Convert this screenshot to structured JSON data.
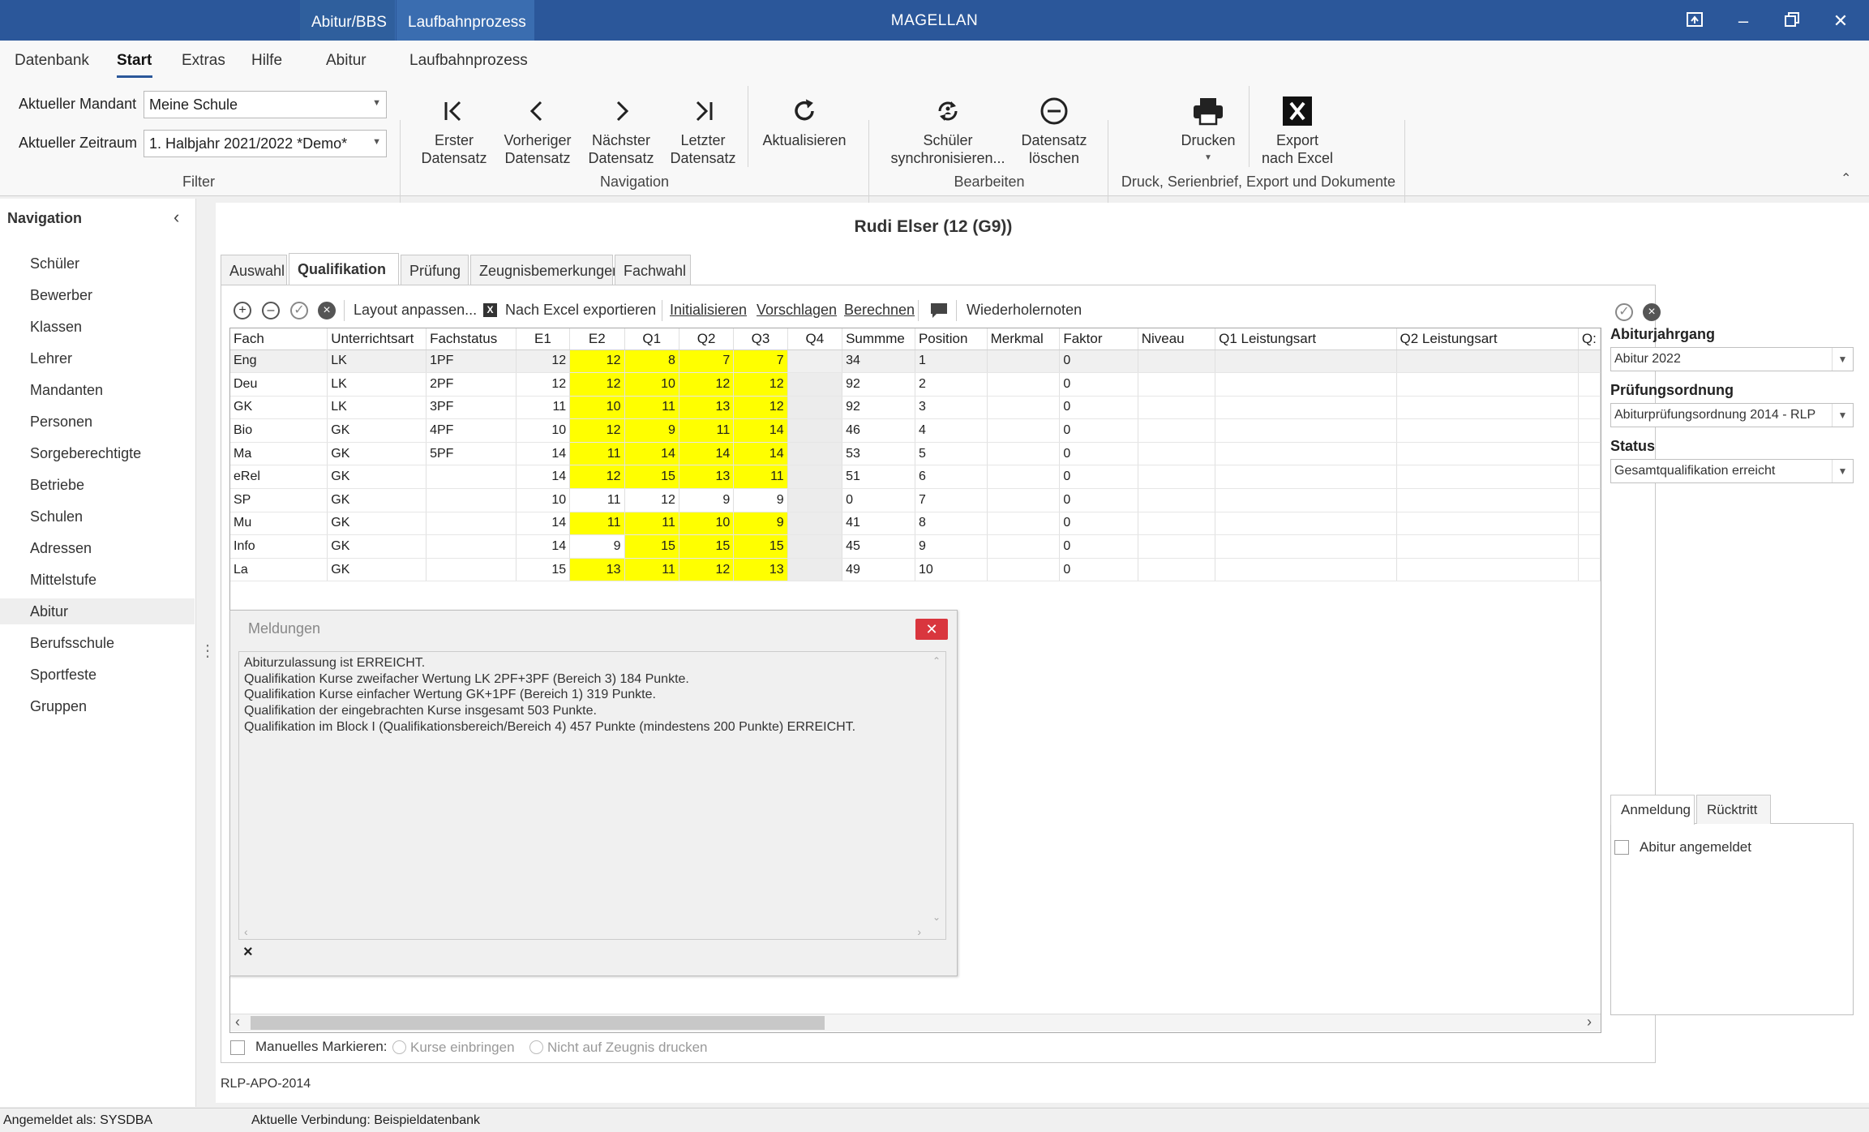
{
  "titlebar": {
    "context_tabs": [
      "Abitur/BBS",
      "Laufbahnprozess"
    ],
    "app_title": "MAGELLAN"
  },
  "menu": [
    "Datenbank",
    "Start",
    "Extras",
    "Hilfe",
    "Abitur",
    "Laufbahnprozess"
  ],
  "filter": {
    "mandant_label": "Aktueller Mandant",
    "mandant_value": "Meine Schule",
    "zeitraum_label": "Aktueller Zeitraum",
    "zeitraum_value": "1. Halbjahr 2021/2022 *Demo*",
    "group_label": "Filter"
  },
  "ribbon": {
    "navigation": {
      "first": "Erster\nDatensatz",
      "prev": "Vorheriger\nDatensatz",
      "next": "Nächster\nDatensatz",
      "last": "Letzter\nDatensatz",
      "refresh": "Aktualisieren",
      "group_label": "Navigation"
    },
    "bearbeiten": {
      "sync": "Schüler\nsynchronisieren...",
      "delete": "Datensatz\nlöschen",
      "group_label": "Bearbeiten"
    },
    "druck": {
      "print": "Drucken",
      "export": "Export\nnach Excel",
      "group_label": "Druck, Serienbrief, Export und Dokumente"
    }
  },
  "navigation": {
    "title": "Navigation",
    "items": [
      "Schüler",
      "Bewerber",
      "Klassen",
      "Lehrer",
      "Mandanten",
      "Personen",
      "Sorgeberechtigte",
      "Betriebe",
      "Schulen",
      "Adressen",
      "Mittelstufe",
      "Abitur",
      "Berufsschule",
      "Sportfeste",
      "Gruppen"
    ],
    "selected": "Abitur"
  },
  "student": {
    "name": "Rudi Elser (12 (G9))"
  },
  "tabs": [
    "Auswahl",
    "Qualifikation",
    "Prüfung",
    "Zeugnisbemerkungen",
    "Fachwahl"
  ],
  "active_tab": "Qualifikation",
  "toolbar": {
    "layout": "Layout anpassen...",
    "excel": "Nach Excel exportieren",
    "init": "Initialisieren",
    "suggest": "Vorschlagen",
    "calc": "Berechnen",
    "repeat": "Wiederholernoten"
  },
  "grid": {
    "columns": [
      "Fach",
      "Unterrichtsart",
      "Fachstatus",
      "E1",
      "E2",
      "Q1",
      "Q2",
      "Q3",
      "Q4",
      "Summme",
      "Position",
      "Merkmal",
      "Faktor",
      "Niveau",
      "Q1 Leistungsart",
      "Q2 Leistungsart",
      "Q:"
    ],
    "rows": [
      {
        "fach": "Eng",
        "art": "LK",
        "status": "1PF",
        "e1": "12",
        "e2": "12",
        "q1": "8",
        "q2": "7",
        "q3": "7",
        "q4": "",
        "summe": "34",
        "pos": "1",
        "merkmal": "",
        "faktor": "0"
      },
      {
        "fach": "Deu",
        "art": "LK",
        "status": "2PF",
        "e1": "12",
        "e2": "12",
        "q1": "10",
        "q2": "12",
        "q3": "12",
        "q4": "",
        "summe": "92",
        "pos": "2",
        "merkmal": "",
        "faktor": "0"
      },
      {
        "fach": "GK",
        "art": "LK",
        "status": "3PF",
        "e1": "11",
        "e2": "10",
        "q1": "11",
        "q2": "13",
        "q3": "12",
        "q4": "",
        "summe": "92",
        "pos": "3",
        "merkmal": "",
        "faktor": "0"
      },
      {
        "fach": "Bio",
        "art": "GK",
        "status": "4PF",
        "e1": "10",
        "e2": "12",
        "q1": "9",
        "q2": "11",
        "q3": "14",
        "q4": "",
        "summe": "46",
        "pos": "4",
        "merkmal": "",
        "faktor": "0"
      },
      {
        "fach": "Ma",
        "art": "GK",
        "status": "5PF",
        "e1": "14",
        "e2": "11",
        "q1": "14",
        "q2": "14",
        "q3": "14",
        "q4": "",
        "summe": "53",
        "pos": "5",
        "merkmal": "",
        "faktor": "0"
      },
      {
        "fach": "eRel",
        "art": "GK",
        "status": "",
        "e1": "14",
        "e2": "12",
        "q1": "15",
        "q2": "13",
        "q3": "11",
        "q4": "",
        "summe": "51",
        "pos": "6",
        "merkmal": "",
        "faktor": "0"
      },
      {
        "fach": "SP",
        "art": "GK",
        "status": "",
        "e1": "10",
        "e2": "11",
        "q1": "12",
        "q2": "9",
        "q3": "9",
        "q4": "",
        "summe": "0",
        "pos": "7",
        "merkmal": "",
        "faktor": "0"
      },
      {
        "fach": "Mu",
        "art": "GK",
        "status": "",
        "e1": "14",
        "e2": "11",
        "q1": "11",
        "q2": "10",
        "q3": "9",
        "q4": "",
        "summe": "41",
        "pos": "8",
        "merkmal": "",
        "faktor": "0"
      },
      {
        "fach": "Info",
        "art": "GK",
        "status": "",
        "e1": "14",
        "e2": "9",
        "q1": "15",
        "q2": "15",
        "q3": "15",
        "q4": "",
        "summe": "45",
        "pos": "9",
        "merkmal": "",
        "faktor": "0"
      },
      {
        "fach": "La",
        "art": "GK",
        "status": "",
        "e1": "15",
        "e2": "13",
        "q1": "11",
        "q2": "12",
        "q3": "13",
        "q4": "",
        "summe": "49",
        "pos": "10",
        "merkmal": "",
        "faktor": "0"
      }
    ],
    "highlight": [
      [
        true,
        true,
        true,
        true
      ],
      [
        true,
        true,
        true,
        true
      ],
      [
        true,
        true,
        true,
        true
      ],
      [
        true,
        true,
        true,
        true
      ],
      [
        true,
        true,
        true,
        true
      ],
      [
        true,
        true,
        true,
        true
      ],
      [
        false,
        false,
        false,
        false
      ],
      [
        true,
        true,
        true,
        true
      ],
      [
        false,
        true,
        true,
        true
      ],
      [
        true,
        true,
        true,
        true
      ]
    ],
    "highlight_color": "#ffff00"
  },
  "dialog": {
    "title": "Meldungen",
    "lines": [
      "Abiturzulassung ist ERREICHT.",
      "Qualifikation Kurse zweifacher Wertung LK 2PF+3PF (Bereich 3) 184 Punkte.",
      "Qualifikation Kurse einfacher Wertung GK+1PF (Bereich 1) 319 Punkte.",
      "Qualifikation der eingebrachten Kurse insgesamt 503 Punkte.",
      "Qualifikation im Block I (Qualifikationsbereich/Bereich 4) 457 Punkte (mindestens 200 Punkte) ERREICHT."
    ]
  },
  "bottom_options": {
    "manual": "Manuelles Markieren:",
    "kurse": "Kurse einbringen",
    "nicht": "Nicht auf Zeugnis drucken"
  },
  "right_panel": {
    "jahrgang_label": "Abiturjahrgang",
    "jahrgang_value": "Abitur 2022",
    "ordnung_label": "Prüfungsordnung",
    "ordnung_value": "Abiturprüfungsordnung 2014 - RLP",
    "status_label": "Status",
    "status_value": "Gesamtqualifikation erreicht",
    "tabs": [
      "Anmeldung",
      "Rücktritt"
    ],
    "checkbox_label": "Abitur angemeldet"
  },
  "footer_code": "RLP-APO-2014",
  "status_bar": {
    "user": "Angemeldet als: SYSDBA",
    "connection": "Aktuelle Verbindung: Beispieldatenbank"
  }
}
